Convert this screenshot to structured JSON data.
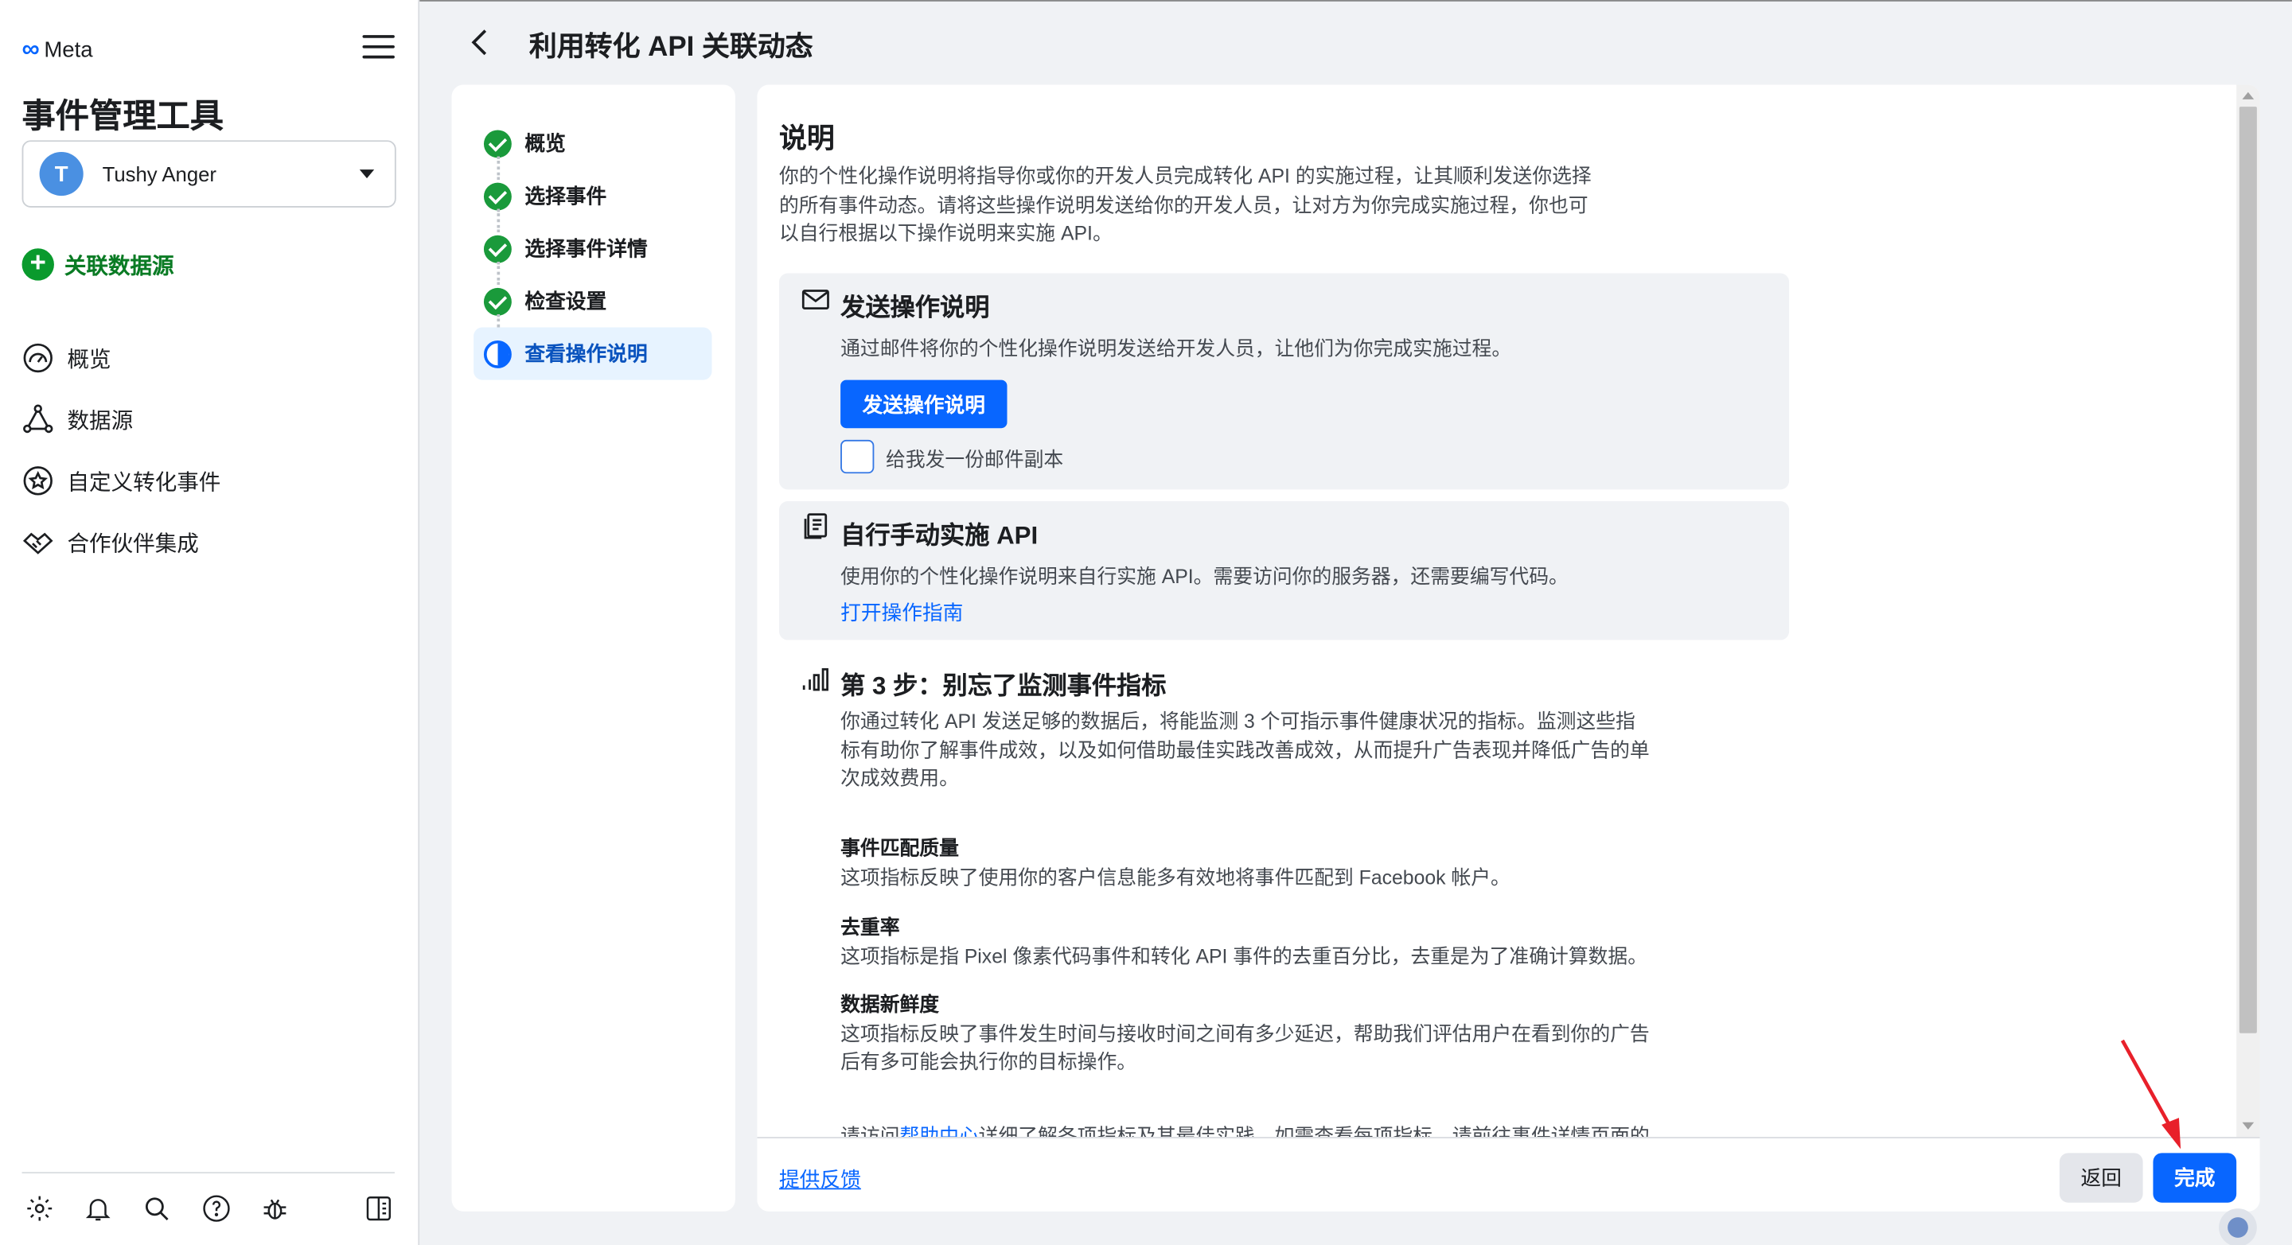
{
  "sidebar": {
    "brand": "Meta",
    "app_title": "事件管理工具",
    "account": {
      "initial": "T",
      "name": "Tushy Anger"
    },
    "connect_label": "关联数据源",
    "nav": [
      {
        "label": "概览",
        "icon": "dashboard-icon"
      },
      {
        "label": "数据源",
        "icon": "data-sources-icon"
      },
      {
        "label": "自定义转化事件",
        "icon": "star-badge-icon"
      },
      {
        "label": "合作伙伴集成",
        "icon": "handshake-icon"
      }
    ],
    "footer_icons": [
      "settings-icon",
      "bell-icon",
      "search-icon",
      "help-icon",
      "bug-icon",
      "panel-toggle-icon"
    ]
  },
  "header": {
    "title": "利用转化 API 关联动态"
  },
  "steps": [
    {
      "label": "概览",
      "state": "done"
    },
    {
      "label": "选择事件",
      "state": "done"
    },
    {
      "label": "选择事件详情",
      "state": "done"
    },
    {
      "label": "检查设置",
      "state": "done"
    },
    {
      "label": "查看操作说明",
      "state": "active"
    }
  ],
  "main": {
    "section_title": "说明",
    "intro": "你的个性化操作说明将指导你或你的开发人员完成转化 API 的实施过程，让其顺利发送你选择的所有事件动态。请将这些操作说明发送给你的开发人员，让对方为你完成实施过程，你也可以自行根据以下操作说明来实施 API。",
    "send_box": {
      "title": "发送操作说明",
      "desc": "通过邮件将你的个性化操作说明发送给开发人员，让他们为你完成实施过程。",
      "button": "发送操作说明",
      "checkbox_label": "给我发一份邮件副本"
    },
    "manual_box": {
      "title": "自行手动实施 API",
      "desc": "使用你的个性化操作说明来自行实施 API。需要访问你的服务器，还需要编写代码。",
      "link": "打开操作指南"
    },
    "step3": {
      "title": "第 3 步：别忘了监测事件指标",
      "desc": "你通过转化 API 发送足够的数据后，将能监测 3 个可指示事件健康状况的指标。监测这些指标有助你了解事件成效，以及如何借助最佳实践改善成效，从而提升广告表现并降低广告的单次成效费用。",
      "metrics": [
        {
          "title": "事件匹配质量",
          "desc": "这项指标反映了使用你的客户信息能多有效地将事件匹配到 Facebook 帐户。"
        },
        {
          "title": "去重率",
          "desc": "这项指标是指 Pixel 像素代码事件和转化 API 事件的去重百分比，去重是为了准确计算数据。"
        },
        {
          "title": "数据新鲜度",
          "desc": "这项指标反映了事件发生时间与接收时间之间有多少延迟，帮助我们评估用户在看到你的广告后有多可能会执行你的目标操作。"
        }
      ],
      "tail_prefix": "请访问",
      "tail_link": "帮助中心",
      "tail_suffix": "详细了解各项指标及其最佳实践。如需查看每项指标，请前往事件详情页面的"
    }
  },
  "footer": {
    "feedback": "提供反馈",
    "back": "返回",
    "done": "完成"
  },
  "colors": {
    "primary": "#0866ff",
    "success": "#1a9a3b",
    "annotation_arrow": "#e8202a"
  }
}
